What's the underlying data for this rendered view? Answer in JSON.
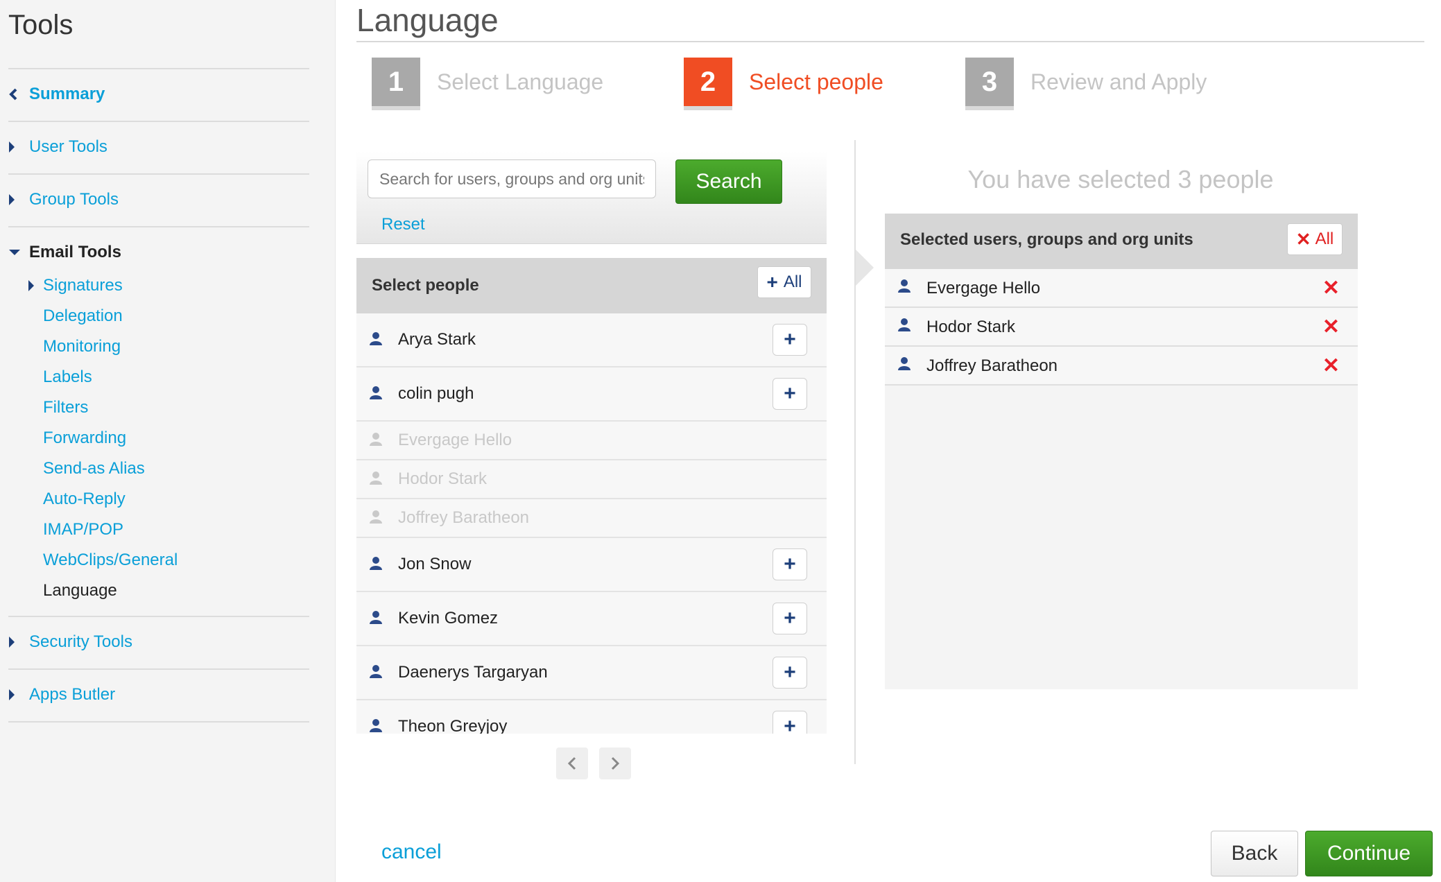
{
  "sidebar": {
    "title": "Tools",
    "summary": "Summary",
    "user_tools": "User Tools",
    "group_tools": "Group Tools",
    "email_tools": "Email Tools",
    "email_sub": [
      "Signatures",
      "Delegation",
      "Monitoring",
      "Labels",
      "Filters",
      "Forwarding",
      "Send-as Alias",
      "Auto-Reply",
      "IMAP/POP",
      "WebClips/General",
      "Language"
    ],
    "security_tools": "Security Tools",
    "apps_butler": "Apps Butler"
  },
  "page": {
    "title": "Language"
  },
  "steps": [
    {
      "num": "1",
      "label": "Select Language",
      "state": "inactive"
    },
    {
      "num": "2",
      "label": "Select people",
      "state": "active"
    },
    {
      "num": "3",
      "label": "Review and Apply",
      "state": "inactive"
    }
  ],
  "search": {
    "placeholder": "Search for users, groups and org units",
    "button": "Search",
    "reset": "Reset"
  },
  "people_list": {
    "title": "Select people",
    "add_all": "All",
    "rows": [
      {
        "name": "Arya Stark",
        "enabled": true
      },
      {
        "name": "colin pugh",
        "enabled": true
      },
      {
        "name": "Evergage Hello",
        "enabled": false
      },
      {
        "name": "Hodor Stark",
        "enabled": false
      },
      {
        "name": "Joffrey Baratheon",
        "enabled": false
      },
      {
        "name": "Jon Snow",
        "enabled": true
      },
      {
        "name": "Kevin Gomez",
        "enabled": true
      },
      {
        "name": "Daenerys Targaryan",
        "enabled": true
      },
      {
        "name": "Theon Greyjoy",
        "enabled": true
      }
    ]
  },
  "selected": {
    "count_text": "You have selected 3 people",
    "title": "Selected users, groups and org units",
    "remove_all": "All",
    "rows": [
      "Evergage Hello",
      "Hodor Stark",
      "Joffrey Baratheon"
    ]
  },
  "footer": {
    "cancel": "cancel",
    "back": "Back",
    "continue": "Continue"
  },
  "colors": {
    "accent": "#0a9fd8",
    "active_step": "#f04d23",
    "primary_button": "#3c9a22",
    "remove": "#e8202a",
    "user_icon": "#2c4b8a"
  }
}
